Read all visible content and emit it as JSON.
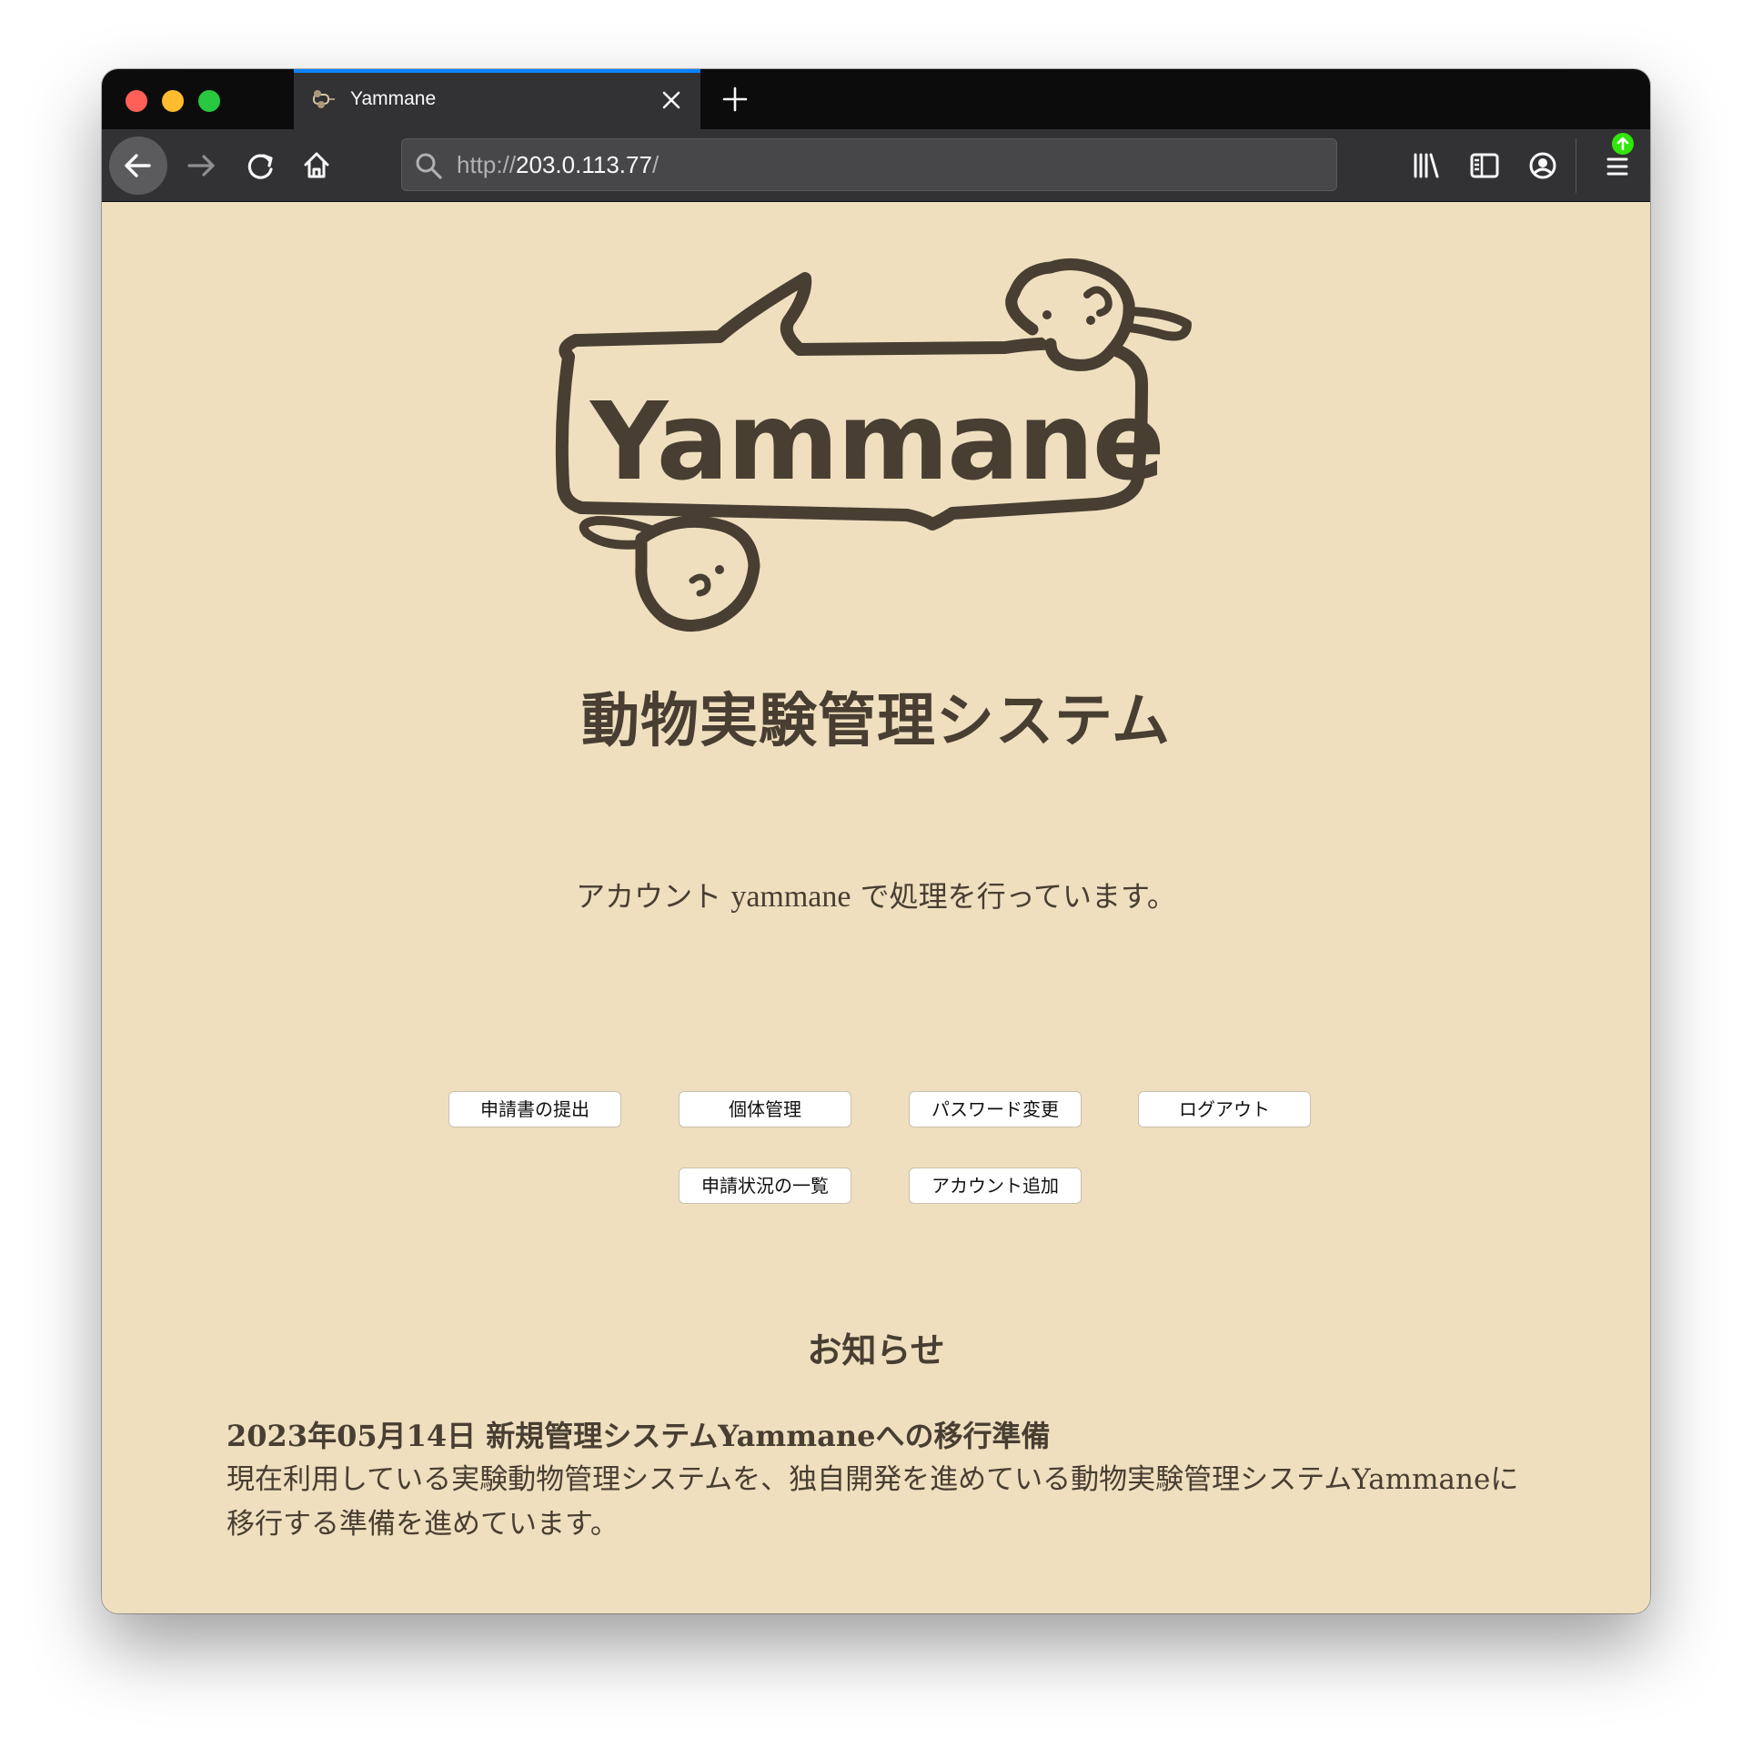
{
  "browser": {
    "tab_title": "Yammane",
    "url_prefix": "http://",
    "url_host": "203.0.113.77",
    "url_suffix": "/"
  },
  "header": {
    "logo_text": "Yammane",
    "title": "動物実験管理システム"
  },
  "account": {
    "prefix": "アカウント ",
    "name": "yammane",
    "suffix": " で処理を行っています。"
  },
  "menu": {
    "buttons": [
      {
        "label": "申請書の提出"
      },
      {
        "label": "個体管理"
      },
      {
        "label": "パスワード変更"
      },
      {
        "label": "ログアウト"
      },
      {
        "label": "申請状況の一覧"
      },
      {
        "label": "アカウント追加"
      }
    ]
  },
  "news": {
    "heading": "お知らせ",
    "items": [
      {
        "title": "2023年05月14日 新規管理システムYammaneへの移行準備",
        "body": "現在利用している実験動物管理システムを、独自開発を進めている動物実験管理システムYammaneに移行する準備を進めています。"
      }
    ]
  },
  "colors": {
    "page_background": "#efdfbf",
    "text": "#483e32",
    "tab_accent": "#0a84ff",
    "update_badge": "#30e60b"
  }
}
